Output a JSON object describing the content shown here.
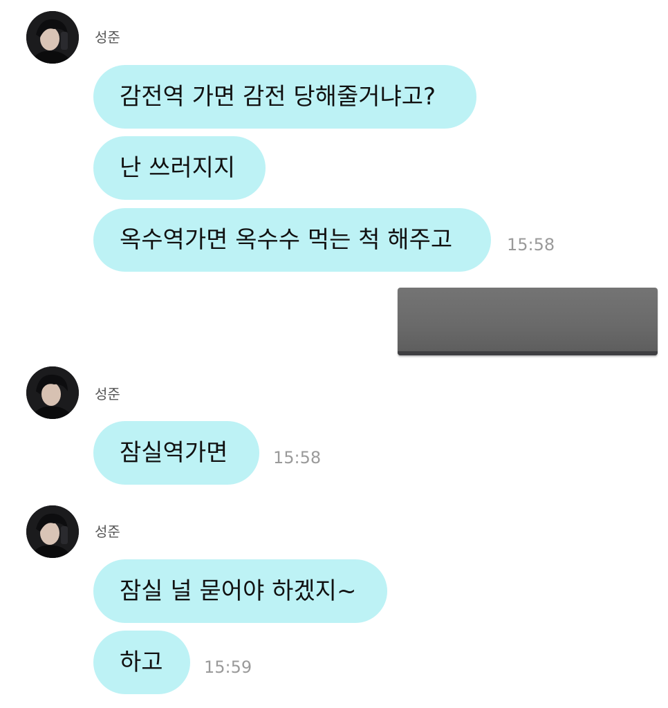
{
  "colors": {
    "bubble": "#bdf2f5",
    "time": "#9a9a9a",
    "sender_name": "#555555",
    "background": "#ffffff"
  },
  "groups": [
    {
      "sender": "성준",
      "messages": [
        "감전역 가면 감전 당해줄거냐고?",
        "난 쓰러지지",
        "옥수역가면 옥수수 먹는 척 해주고"
      ],
      "time": "15:58"
    },
    {
      "sender": "성준",
      "messages": [
        "잠실역가면"
      ],
      "time": "15:58"
    },
    {
      "sender": "성준",
      "messages": [
        "잠실 널 묻어야 하겠지~",
        "하고"
      ],
      "time": "15:59"
    }
  ],
  "sent_image": {
    "icon": "gray-image-thumbnail"
  }
}
